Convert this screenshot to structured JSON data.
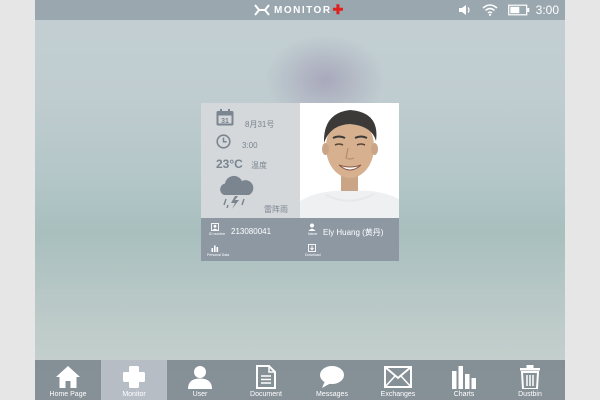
{
  "header": {
    "brand_wordmark": "MONITOR",
    "brand_cross": "✚",
    "clock": "3:00",
    "icons": [
      "volume-icon",
      "wifi-icon",
      "battery-icon"
    ]
  },
  "card": {
    "calendar_day": "31",
    "date": "8月31号",
    "time": "3:00",
    "temperature": "23°C",
    "temperature_label": "温度",
    "weather": "雷阵雨",
    "id_label": "ID number",
    "id_value": "213080041",
    "name_label": "Name",
    "name_value": "Ely Huang (黄丹)",
    "personal_data_label": "Personal Data",
    "download_label": "Download"
  },
  "taskbar": {
    "active": "Monitor",
    "items": [
      {
        "label": "Home Page",
        "icon": "home-icon"
      },
      {
        "label": "Monitor",
        "icon": "cross-icon"
      },
      {
        "label": "User",
        "icon": "user-icon"
      },
      {
        "label": "Document",
        "icon": "document-icon"
      },
      {
        "label": "Messages",
        "icon": "message-icon"
      },
      {
        "label": "Exchanges",
        "icon": "envelope-icon"
      },
      {
        "label": "Charts",
        "icon": "bar-chart-icon"
      },
      {
        "label": "Dustbin",
        "icon": "trash-icon"
      }
    ]
  },
  "colors": {
    "accent_red": "#e0201c",
    "taskbar": "#737d87",
    "card_panel": "#d5d8db",
    "card_info": "#8d98a3"
  }
}
